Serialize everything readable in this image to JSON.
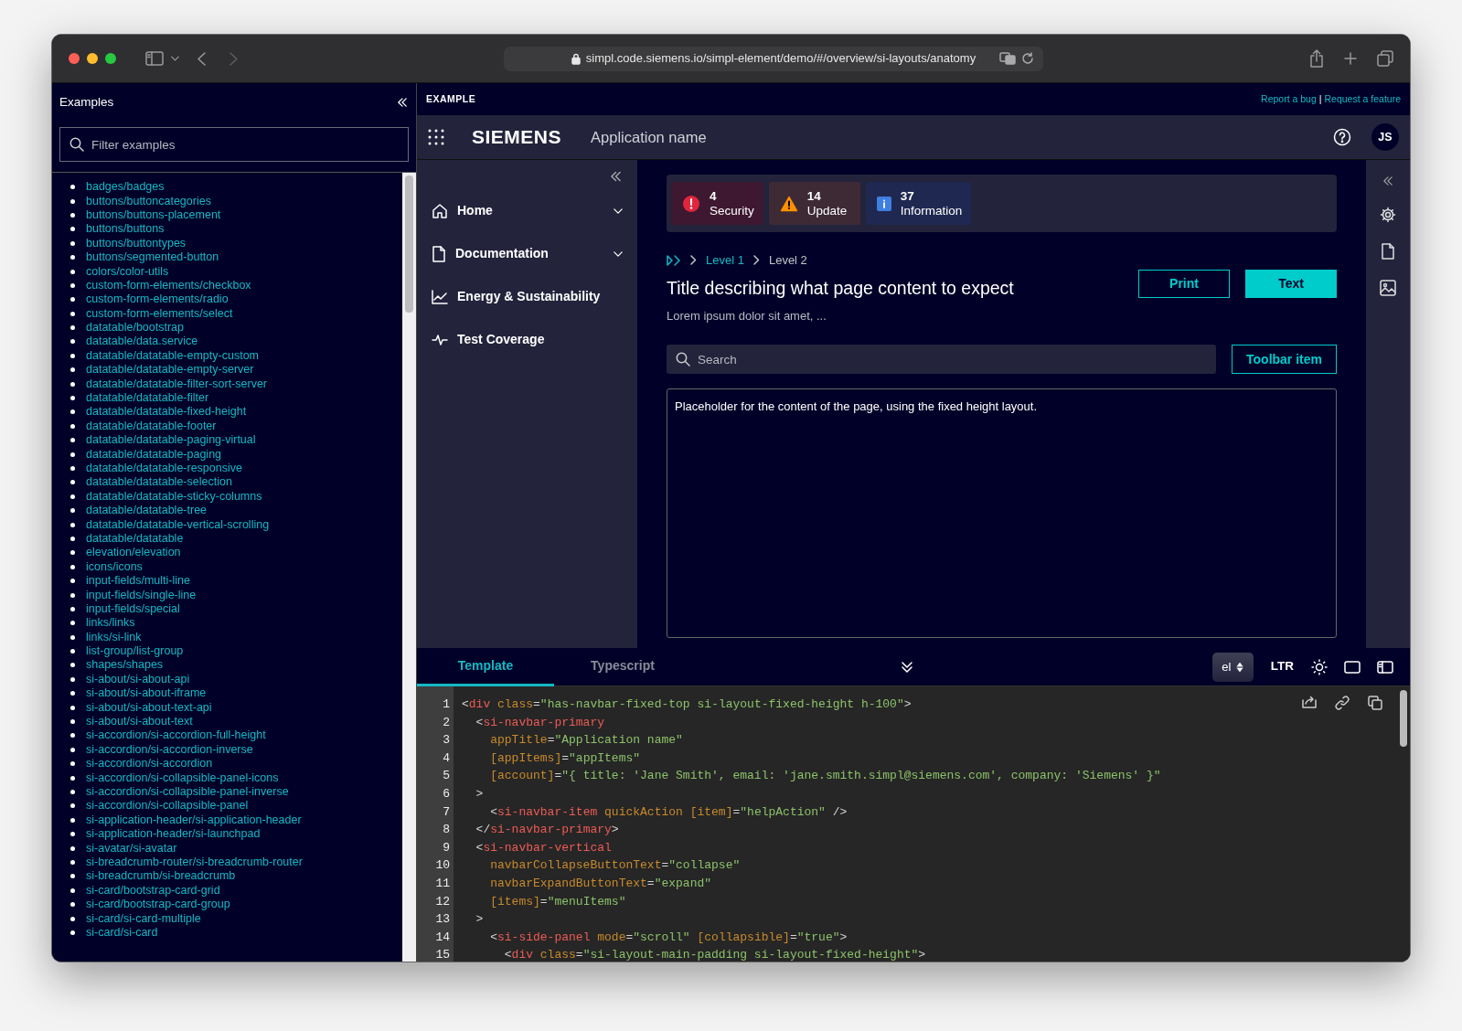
{
  "browser": {
    "url": "simpl.code.siemens.io/simpl-element/demo/#/overview/si-layouts/anatomy"
  },
  "sidebar": {
    "title": "Examples",
    "filter": {
      "placeholder": "Filter examples"
    },
    "items": [
      "badges/badges",
      "buttons/buttoncategories",
      "buttons/buttons-placement",
      "buttons/buttons",
      "buttons/buttontypes",
      "buttons/segmented-button",
      "colors/color-utils",
      "custom-form-elements/checkbox",
      "custom-form-elements/radio",
      "custom-form-elements/select",
      "datatable/bootstrap",
      "datatable/data.service",
      "datatable/datatable-empty-custom",
      "datatable/datatable-empty-server",
      "datatable/datatable-filter-sort-server",
      "datatable/datatable-filter",
      "datatable/datatable-fixed-height",
      "datatable/datatable-footer",
      "datatable/datatable-paging-virtual",
      "datatable/datatable-paging",
      "datatable/datatable-responsive",
      "datatable/datatable-selection",
      "datatable/datatable-sticky-columns",
      "datatable/datatable-tree",
      "datatable/datatable-vertical-scrolling",
      "datatable/datatable",
      "elevation/elevation",
      "icons/icons",
      "input-fields/multi-line",
      "input-fields/single-line",
      "input-fields/special",
      "links/links",
      "links/si-link",
      "list-group/list-group",
      "shapes/shapes",
      "si-about/si-about-api",
      "si-about/si-about-iframe",
      "si-about/si-about-text-api",
      "si-about/si-about-text",
      "si-accordion/si-accordion-full-height",
      "si-accordion/si-accordion-inverse",
      "si-accordion/si-accordion",
      "si-accordion/si-collapsible-panel-icons",
      "si-accordion/si-collapsible-panel-inverse",
      "si-accordion/si-collapsible-panel",
      "si-application-header/si-application-header",
      "si-application-header/si-launchpad",
      "si-avatar/si-avatar",
      "si-breadcrumb-router/si-breadcrumb-router",
      "si-breadcrumb/si-breadcrumb",
      "si-card/bootstrap-card-grid",
      "si-card/bootstrap-card-group",
      "si-card/si-card-multiple",
      "si-card/si-card"
    ]
  },
  "example_bar": {
    "label": "EXAMPLE",
    "links": [
      "Report a bug",
      "Request a feature"
    ],
    "separator": "|"
  },
  "navbar": {
    "brand": "SIEMENS",
    "app_name": "Application name",
    "avatar": "JS"
  },
  "nav_items": [
    {
      "label": "Home",
      "expandable": true
    },
    {
      "label": "Documentation",
      "expandable": true
    },
    {
      "label": "Energy & Sustainability",
      "expandable": false
    },
    {
      "label": "Test Coverage",
      "expandable": false
    }
  ],
  "status": [
    {
      "count": "4",
      "label": "Security",
      "kind": "danger"
    },
    {
      "count": "14",
      "label": "Update",
      "kind": "warning"
    },
    {
      "count": "37",
      "label": "Information",
      "kind": "info"
    }
  ],
  "breadcrumb": [
    {
      "label": "Level 1",
      "current": false
    },
    {
      "label": "Level 2",
      "current": true
    }
  ],
  "page": {
    "title": "Title describing what page content to expect",
    "subtitle": "Lorem ipsum dolor sit amet, ...",
    "buttons": [
      {
        "label": "Print",
        "kind": "outline"
      },
      {
        "label": "Text",
        "kind": "primary"
      }
    ],
    "search": {
      "placeholder": "Search"
    },
    "toolbar_button": "Toolbar item",
    "content": "Placeholder for the content of the page, using the fixed height layout."
  },
  "code_tabs": [
    {
      "label": "Template",
      "selected": true
    },
    {
      "label": "Typescript",
      "selected": false
    }
  ],
  "code_toolbar": {
    "locale": "el",
    "direction": "LTR"
  },
  "code_lines": [
    {
      "number": "1",
      "tokens": [
        {
          "kind": "p",
          "text": "<"
        },
        {
          "kind": "tag",
          "text": "div"
        },
        {
          "kind": "attr",
          "text": " class"
        },
        {
          "kind": "p",
          "text": "="
        },
        {
          "kind": "str",
          "text": "\"has-navbar-fixed-top si-layout-fixed-height h-100\""
        },
        {
          "kind": "p",
          "text": ">"
        }
      ]
    },
    {
      "number": "2",
      "tokens": [
        {
          "kind": "p",
          "text": "  <"
        },
        {
          "kind": "tag",
          "text": "si-navbar-primary"
        }
      ]
    },
    {
      "number": "3",
      "tokens": [
        {
          "kind": "attr",
          "text": "    appTitle"
        },
        {
          "kind": "p",
          "text": "="
        },
        {
          "kind": "str",
          "text": "\"Application name\""
        }
      ]
    },
    {
      "number": "4",
      "tokens": [
        {
          "kind": "attr",
          "text": "    [appItems]"
        },
        {
          "kind": "p",
          "text": "="
        },
        {
          "kind": "str",
          "text": "\"appItems\""
        }
      ]
    },
    {
      "number": "5",
      "tokens": [
        {
          "kind": "attr",
          "text": "    [account]"
        },
        {
          "kind": "p",
          "text": "="
        },
        {
          "kind": "str",
          "text": "\"{ title: 'Jane Smith', email: 'jane.smith.simpl@siemens.com', company: 'Siemens' }\""
        }
      ]
    },
    {
      "number": "6",
      "tokens": [
        {
          "kind": "p",
          "text": "  >"
        }
      ]
    },
    {
      "number": "7",
      "tokens": [
        {
          "kind": "p",
          "text": "    <"
        },
        {
          "kind": "tag",
          "text": "si-navbar-item"
        },
        {
          "kind": "attr",
          "text": " quickAction"
        },
        {
          "kind": "attr",
          "text": " [item]"
        },
        {
          "kind": "p",
          "text": "="
        },
        {
          "kind": "str",
          "text": "\"helpAction\""
        },
        {
          "kind": "p",
          "text": " />"
        }
      ]
    },
    {
      "number": "8",
      "tokens": [
        {
          "kind": "p",
          "text": "  </"
        },
        {
          "kind": "tag",
          "text": "si-navbar-primary"
        },
        {
          "kind": "p",
          "text": ">"
        }
      ]
    },
    {
      "number": "9",
      "tokens": [
        {
          "kind": "p",
          "text": "  <"
        },
        {
          "kind": "tag",
          "text": "si-navbar-vertical"
        }
      ]
    },
    {
      "number": "10",
      "tokens": [
        {
          "kind": "attr",
          "text": "    navbarCollapseButtonText"
        },
        {
          "kind": "p",
          "text": "="
        },
        {
          "kind": "str",
          "text": "\"collapse\""
        }
      ]
    },
    {
      "number": "11",
      "tokens": [
        {
          "kind": "attr",
          "text": "    navbarExpandButtonText"
        },
        {
          "kind": "p",
          "text": "="
        },
        {
          "kind": "str",
          "text": "\"expand\""
        }
      ]
    },
    {
      "number": "12",
      "tokens": [
        {
          "kind": "attr",
          "text": "    [items]"
        },
        {
          "kind": "p",
          "text": "="
        },
        {
          "kind": "str",
          "text": "\"menuItems\""
        }
      ]
    },
    {
      "number": "13",
      "tokens": [
        {
          "kind": "p",
          "text": "  >"
        }
      ]
    },
    {
      "number": "14",
      "tokens": [
        {
          "kind": "p",
          "text": "    <"
        },
        {
          "kind": "tag",
          "text": "si-side-panel"
        },
        {
          "kind": "attr",
          "text": " mode"
        },
        {
          "kind": "p",
          "text": "="
        },
        {
          "kind": "str",
          "text": "\"scroll\""
        },
        {
          "kind": "attr",
          "text": " [collapsible]"
        },
        {
          "kind": "p",
          "text": "="
        },
        {
          "kind": "str",
          "text": "\"true\""
        },
        {
          "kind": "p",
          "text": ">"
        }
      ]
    },
    {
      "number": "15",
      "tokens": [
        {
          "kind": "p",
          "text": "      <"
        },
        {
          "kind": "tag",
          "text": "div"
        },
        {
          "kind": "attr",
          "text": " class"
        },
        {
          "kind": "p",
          "text": "="
        },
        {
          "kind": "str",
          "text": "\"si-layout-main-padding si-layout-fixed-height\""
        },
        {
          "kind": "p",
          "text": ">"
        }
      ]
    }
  ]
}
